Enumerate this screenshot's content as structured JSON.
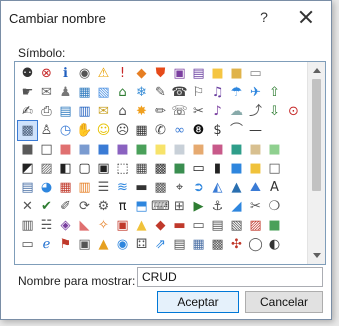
{
  "dialog": {
    "title": "Cambiar nombre",
    "help_glyph": "?",
    "symbol_label": "Símbolo:",
    "display_name_label": "Nombre para mostrar:",
    "display_name_value": "CRUD",
    "ok_label": "Aceptar",
    "cancel_label": "Cancelar"
  },
  "symbols": [
    {
      "g": "⚉",
      "c": "#333",
      "n": "hierarchy-icon"
    },
    {
      "g": "⊗",
      "c": "#c62828",
      "n": "stop-x-icon"
    },
    {
      "g": "ℹ",
      "c": "#1f5fbf",
      "n": "info-icon"
    },
    {
      "g": "◉",
      "c": "#555",
      "n": "record-icon"
    },
    {
      "g": "⚠",
      "c": "#e8a000",
      "n": "warning-icon"
    },
    {
      "g": "!",
      "c": "#c62828",
      "n": "exclamation-icon"
    },
    {
      "g": "◆",
      "c": "#e67e22",
      "n": "diamond-warning-icon"
    },
    {
      "g": "⛊",
      "c": "#e64a19",
      "n": "shield-icon"
    },
    {
      "g": "▣",
      "c": "#7b3fa0",
      "n": "save-icon"
    },
    {
      "g": "▤",
      "c": "#6a3fa0",
      "n": "disk-icon"
    },
    {
      "g": "■",
      "c": "#f5c542",
      "n": "folder-icon"
    },
    {
      "g": "■",
      "c": "#e0b34a",
      "n": "folder-open-icon"
    },
    {
      "g": "▭",
      "c": "#888",
      "n": "blank-1"
    },
    {
      "g": "",
      "c": "#000",
      "n": "empty-1"
    },
    {
      "g": "",
      "c": "#000",
      "n": "empty-2"
    },
    {
      "g": "☛",
      "c": "#555",
      "n": "pointer-icon"
    },
    {
      "g": "✉",
      "c": "#666",
      "n": "mail-icon"
    },
    {
      "g": "♟",
      "c": "#777",
      "n": "user-icon"
    },
    {
      "g": "▦",
      "c": "#2f7bbf",
      "n": "grid-icon"
    },
    {
      "g": "▧",
      "c": "#4a90e2",
      "n": "calendar-icon"
    },
    {
      "g": "⌂",
      "c": "#2e7d32",
      "n": "home-icon"
    },
    {
      "g": "❄",
      "c": "#3a8ed6",
      "n": "snow-icon"
    },
    {
      "g": "✎",
      "c": "#555",
      "n": "edit-icon"
    },
    {
      "g": "☎",
      "c": "#444",
      "n": "phone-icon"
    },
    {
      "g": "⚐",
      "c": "#555",
      "n": "flag-icon"
    },
    {
      "g": "♫",
      "c": "#6a3fa0",
      "n": "music-icon"
    },
    {
      "g": "☂",
      "c": "#2e86de",
      "n": "umbrella-icon"
    },
    {
      "g": "✈",
      "c": "#2e86de",
      "n": "plane-icon"
    },
    {
      "g": "⇧",
      "c": "#2e7d32",
      "n": "upload-icon"
    },
    {
      "g": "",
      "c": "#000",
      "n": "empty-3"
    },
    {
      "g": "✍",
      "c": "#444",
      "n": "pin-icon"
    },
    {
      "g": "⎙",
      "c": "#444",
      "n": "print-icon"
    },
    {
      "g": "▤",
      "c": "#2f7bbf",
      "n": "list-icon"
    },
    {
      "g": "▥",
      "c": "#1f5fbf",
      "n": "table-icon"
    },
    {
      "g": "✉",
      "c": "#c9a227",
      "n": "envelope-icon"
    },
    {
      "g": "⌂",
      "c": "#555",
      "n": "house-icon"
    },
    {
      "g": "✸",
      "c": "#f0a020",
      "n": "sun-icon"
    },
    {
      "g": "✏",
      "c": "#555",
      "n": "pencil-icon"
    },
    {
      "g": "☏",
      "c": "#333",
      "n": "phone2-icon"
    },
    {
      "g": "✂",
      "c": "#555",
      "n": "scissors-icon"
    },
    {
      "g": "♪",
      "c": "#7a3fa0",
      "n": "note-icon"
    },
    {
      "g": "☁",
      "c": "#8aa",
      "n": "cloud-icon"
    },
    {
      "g": "⤴",
      "c": "#555",
      "n": "share-icon"
    },
    {
      "g": "⇩",
      "c": "#2e7d32",
      "n": "download-icon"
    },
    {
      "g": "⊙",
      "c": "#c62828",
      "n": "back-icon"
    },
    {
      "g": "▩",
      "c": "#4a5d78",
      "n": "person-selected",
      "sel": true
    },
    {
      "g": "♙",
      "c": "#444",
      "n": "person-icon"
    },
    {
      "g": "◷",
      "c": "#3a7bd5",
      "n": "clock-icon"
    },
    {
      "g": "✋",
      "c": "#666",
      "n": "hand-icon"
    },
    {
      "g": "☺",
      "c": "#e6c200",
      "n": "smile-icon"
    },
    {
      "g": "☹",
      "c": "#444",
      "n": "sad-icon"
    },
    {
      "g": "▦",
      "c": "#333",
      "n": "calculator-icon"
    },
    {
      "g": "✆",
      "c": "#444",
      "n": "mobile-icon"
    },
    {
      "g": "∞",
      "c": "#3a7bd5",
      "n": "loop-icon"
    },
    {
      "g": "❽",
      "c": "#111",
      "n": "eight-ball-icon"
    },
    {
      "g": "$",
      "c": "#333",
      "n": "dollar-icon"
    },
    {
      "g": "⌒",
      "c": "#555",
      "n": "mouse-icon"
    },
    {
      "g": "—",
      "c": "#333",
      "n": "dash-icon"
    },
    {
      "g": "",
      "c": "#000",
      "n": "empty-4"
    },
    {
      "g": "",
      "c": "#000",
      "n": "empty-5"
    },
    {
      "g": "■",
      "c": "#5a5a5a",
      "n": "swatch-dark"
    },
    {
      "g": "□",
      "c": "#444",
      "n": "swatch-empty"
    },
    {
      "g": "■",
      "c": "#e07070",
      "n": "swatch-red"
    },
    {
      "g": "■",
      "c": "#7a9bd0",
      "n": "swatch-blue"
    },
    {
      "g": "■",
      "c": "#3a7bd5",
      "n": "swatch-blue2"
    },
    {
      "g": "■",
      "c": "#8a62c0",
      "n": "swatch-purple"
    },
    {
      "g": "■",
      "c": "#4aa05a",
      "n": "swatch-green"
    },
    {
      "g": "■",
      "c": "#f7e36a",
      "n": "swatch-yellow"
    },
    {
      "g": "■",
      "c": "#c8d0d8",
      "n": "swatch-gray"
    },
    {
      "g": "■",
      "c": "#e6aa70",
      "n": "swatch-orange"
    },
    {
      "g": "■",
      "c": "#c85a8a",
      "n": "swatch-pink"
    },
    {
      "g": "■",
      "c": "#2f9e8a",
      "n": "swatch-teal"
    },
    {
      "g": "■",
      "c": "#d8c090",
      "n": "swatch-tan"
    },
    {
      "g": "■",
      "c": "#8fd08f",
      "n": "swatch-lime"
    },
    {
      "g": "",
      "c": "#000",
      "n": "empty-6"
    },
    {
      "g": "◩",
      "c": "#222",
      "n": "half-square-icon"
    },
    {
      "g": "▨",
      "c": "#666",
      "n": "hatched-icon"
    },
    {
      "g": "◧",
      "c": "#222",
      "n": "half-left-icon"
    },
    {
      "g": "▢",
      "c": "#222",
      "n": "frame-icon"
    },
    {
      "g": "▣",
      "c": "#222",
      "n": "frame2-icon"
    },
    {
      "g": "⬚",
      "c": "#222",
      "n": "dashed-box-icon"
    },
    {
      "g": "▦",
      "c": "#444",
      "n": "grid2-icon"
    },
    {
      "g": "▩",
      "c": "#333",
      "n": "checker-icon"
    },
    {
      "g": "■",
      "c": "#3a8e50",
      "n": "green-block-icon"
    },
    {
      "g": "▭",
      "c": "#222",
      "n": "rectangle-icon"
    },
    {
      "g": "▮",
      "c": "#222",
      "n": "bar-icon"
    },
    {
      "g": "■",
      "c": "#2e86de",
      "n": "blue-block-icon"
    },
    {
      "g": "■",
      "c": "#f0c23a",
      "n": "yellow-block-icon"
    },
    {
      "g": "□",
      "c": "#555",
      "n": "box-icon"
    },
    {
      "g": "",
      "c": "#000",
      "n": "empty-7"
    },
    {
      "g": "▤",
      "c": "#4a6fa5",
      "n": "doc-icon"
    },
    {
      "g": "◕",
      "c": "#2e86de",
      "n": "pie-icon"
    },
    {
      "g": "▦",
      "c": "#c0392b",
      "n": "bars-icon"
    },
    {
      "g": "▥",
      "c": "#e67e22",
      "n": "columns-icon"
    },
    {
      "g": "☰",
      "c": "#555",
      "n": "menu-icon"
    },
    {
      "g": "≋",
      "c": "#2e86de",
      "n": "waves-icon"
    },
    {
      "g": "▬",
      "c": "#333",
      "n": "hbar-icon"
    },
    {
      "g": "▩",
      "c": "#555",
      "n": "mosaic-icon"
    },
    {
      "g": "⌖",
      "c": "#333",
      "n": "target-icon"
    },
    {
      "g": "➲",
      "c": "#2e86de",
      "n": "arrow-right-circle-icon"
    },
    {
      "g": "◭",
      "c": "#3a7bd5",
      "n": "triangle-chart-icon"
    },
    {
      "g": "▲",
      "c": "#2a6fb0",
      "n": "mountain-icon"
    },
    {
      "g": "⛰",
      "c": "#3a7bd5",
      "n": "mountain2-icon"
    },
    {
      "g": "A",
      "c": "#333",
      "n": "text-a-icon"
    },
    {
      "g": "",
      "c": "#000",
      "n": "empty-8"
    },
    {
      "g": "✕",
      "c": "#555",
      "n": "cross-icon"
    },
    {
      "g": "✔",
      "c": "#2e7d32",
      "n": "check-icon"
    },
    {
      "g": "✐",
      "c": "#555",
      "n": "ruler-icon"
    },
    {
      "g": "⟳",
      "c": "#555",
      "n": "refresh-icon"
    },
    {
      "g": "⚙",
      "c": "#555",
      "n": "gear-icon"
    },
    {
      "g": "π",
      "c": "#222",
      "n": "pi-icon"
    },
    {
      "g": "⬒",
      "c": "#2e86de",
      "n": "bucket-icon"
    },
    {
      "g": "⌨",
      "c": "#555",
      "n": "brush-icon"
    },
    {
      "g": "⊞",
      "c": "#555",
      "n": "grid3-icon"
    },
    {
      "g": "▶",
      "c": "#2e7d32",
      "n": "play-icon"
    },
    {
      "g": "⚓",
      "c": "#555",
      "n": "anchor-icon"
    },
    {
      "g": "◢",
      "c": "#2e86de",
      "n": "triangle-icon"
    },
    {
      "g": "✂",
      "c": "#555",
      "n": "cut-icon"
    },
    {
      "g": "❍",
      "c": "#555",
      "n": "circle-icon"
    },
    {
      "g": "",
      "c": "#000",
      "n": "empty-9"
    },
    {
      "g": "▥",
      "c": "#555",
      "n": "copy-icon"
    },
    {
      "g": "☵",
      "c": "#555",
      "n": "paste-icon"
    },
    {
      "g": "◈",
      "c": "#7a3fa0",
      "n": "shapes-icon"
    },
    {
      "g": "◣",
      "c": "#e07070",
      "n": "eraser-icon"
    },
    {
      "g": "✧",
      "c": "#e67e22",
      "n": "sparkle-icon"
    },
    {
      "g": "▣",
      "c": "#c0392b",
      "n": "palette-icon"
    },
    {
      "g": "▲",
      "c": "#f0c23a",
      "n": "bell-icon"
    },
    {
      "g": "◆",
      "c": "#c0392b",
      "n": "stamp-icon"
    },
    {
      "g": "▬",
      "c": "#c0392b",
      "n": "folder-red-icon"
    },
    {
      "g": "▭",
      "c": "#555",
      "n": "card-icon"
    },
    {
      "g": "▤",
      "c": "#555",
      "n": "form-icon"
    },
    {
      "g": "▧",
      "c": "#555",
      "n": "notes-icon"
    },
    {
      "g": "▨",
      "c": "#c0392b",
      "n": "stripe-icon"
    },
    {
      "g": "■",
      "c": "#4aa05a",
      "n": "green-icon"
    },
    {
      "g": "",
      "c": "#000",
      "n": "empty-10"
    },
    {
      "g": "▭",
      "c": "#555",
      "n": "window-icon"
    },
    {
      "g": "ℯ",
      "c": "#1f6fd0",
      "n": "browser-icon"
    },
    {
      "g": "⚑",
      "c": "#c0392b",
      "n": "signpost-icon"
    },
    {
      "g": "▣",
      "c": "#555",
      "n": "book-icon"
    },
    {
      "g": "▲",
      "c": "#e6a020",
      "n": "tent-icon"
    },
    {
      "g": "◉",
      "c": "#2e86de",
      "n": "globe-icon"
    },
    {
      "g": "⚃",
      "c": "#555",
      "n": "cube-icon"
    },
    {
      "g": "⇗",
      "c": "#2e86de",
      "n": "arrow-ne-icon"
    },
    {
      "g": "▤",
      "c": "#555",
      "n": "ledger-icon"
    },
    {
      "g": "▦",
      "c": "#4a6fa5",
      "n": "spreadsheet-icon"
    },
    {
      "g": "▩",
      "c": "#555",
      "n": "mesh-icon"
    },
    {
      "g": "✣",
      "c": "#c0392b",
      "n": "asterisk-icon"
    },
    {
      "g": "◯",
      "c": "#555",
      "n": "ring-icon"
    },
    {
      "g": "◐",
      "c": "#333",
      "n": "half-circle-icon"
    },
    {
      "g": "",
      "c": "#000",
      "n": "empty-11"
    }
  ]
}
